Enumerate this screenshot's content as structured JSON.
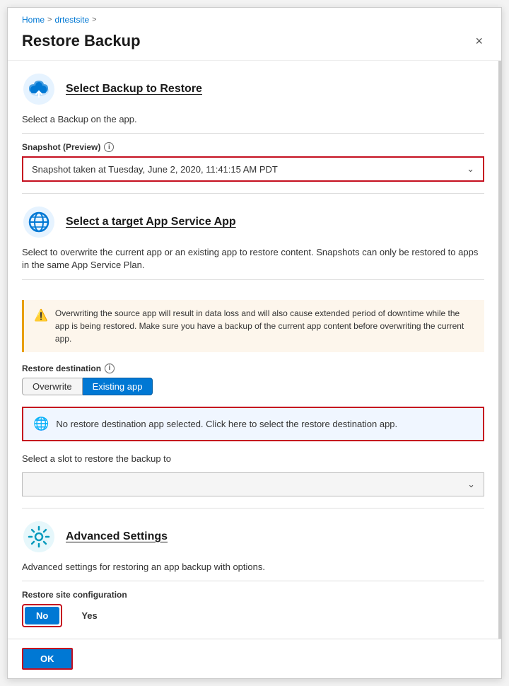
{
  "breadcrumb": {
    "home": "Home",
    "separator1": ">",
    "site": "drtestsite",
    "separator2": ">"
  },
  "header": {
    "title": "Restore Backup",
    "close_label": "×"
  },
  "section1": {
    "title": "Select Backup to Restore",
    "desc": "Select a Backup on the app."
  },
  "snapshot_field": {
    "label": "Snapshot (Preview)",
    "value": "Snapshot taken at Tuesday, June 2, 2020, 11:41:15 AM PDT"
  },
  "section2": {
    "title": "Select a target App Service App",
    "desc": "Select to overwrite the current app or an existing app to restore content. Snapshots can only be restored to apps in the same App Service Plan."
  },
  "warning": {
    "text": "Overwriting the source app will result in data loss and will also cause extended period of downtime while the app is being restored. Make sure you have a backup of the current app content before overwriting the current app."
  },
  "restore_destination": {
    "label": "Restore destination",
    "options": [
      "Overwrite",
      "Existing app"
    ],
    "selected": "Existing app"
  },
  "destination_selector": {
    "text": "No restore destination app selected. Click here to select the restore destination app."
  },
  "slot_field": {
    "label": "Select a slot to restore the backup to",
    "placeholder": ""
  },
  "section3": {
    "title": "Advanced Settings",
    "desc": "Advanced settings for restoring an app backup with options."
  },
  "restore_site_config": {
    "label": "Restore site configuration",
    "options": [
      "No",
      "Yes"
    ],
    "selected": "No"
  },
  "footer": {
    "ok_label": "OK"
  }
}
